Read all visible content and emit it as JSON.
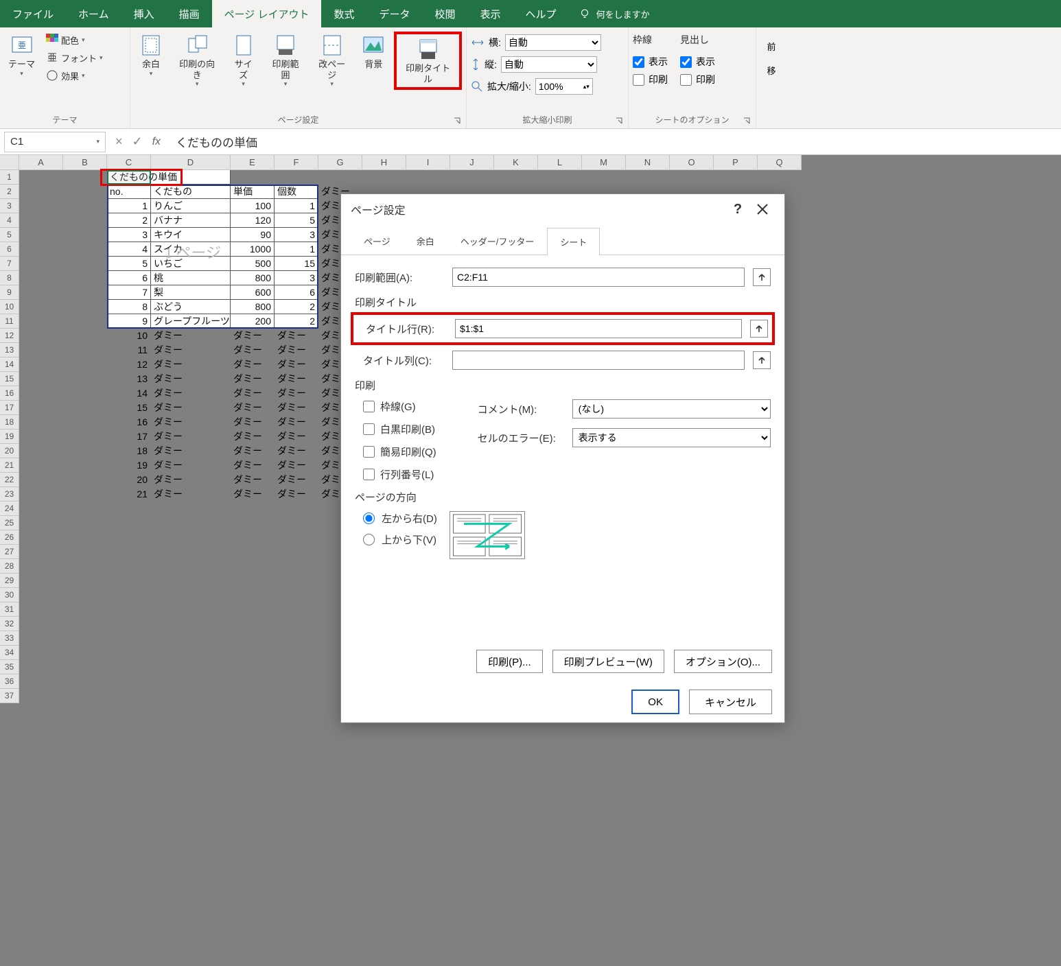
{
  "ribbonTabs": {
    "file": "ファイル",
    "home": "ホーム",
    "insert": "挿入",
    "draw": "描画",
    "pageLayout": "ページ レイアウト",
    "formulas": "数式",
    "data": "データ",
    "review": "校閲",
    "view": "表示",
    "help": "ヘルプ",
    "tellMe": "何をしますか"
  },
  "ribbon": {
    "themes": {
      "label": "テーマ",
      "theme": "テーマ",
      "colors": "配色",
      "fonts": "フォント",
      "effects": "効果"
    },
    "pageSetup": {
      "label": "ページ設定",
      "margins": "余白",
      "orientation": "印刷の向き",
      "size": "サイズ",
      "printArea": "印刷範囲",
      "breaks": "改ページ",
      "background": "背景",
      "printTitles": "印刷タイトル"
    },
    "scale": {
      "label": "拡大縮小印刷",
      "width": "横:",
      "height": "縦:",
      "auto": "自動",
      "scale": "拡大/縮小:",
      "scaleVal": "100%"
    },
    "sheetOptions": {
      "label": "シートのオプション",
      "gridlines": "枠線",
      "headings": "見出し",
      "view": "表示",
      "print": "印刷"
    },
    "arrange": {
      "label1": "前",
      "label2": "移"
    }
  },
  "namebox": "C1",
  "formulaText": "くだものの単価",
  "columns": [
    "A",
    "B",
    "C",
    "D",
    "E",
    "F",
    "G",
    "H",
    "I",
    "J",
    "K",
    "L",
    "M",
    "N",
    "O",
    "P",
    "Q"
  ],
  "rowCount": 37,
  "pageWatermark": "1 ページ",
  "table": {
    "title": "くだものの単価",
    "headers": {
      "no": "no.",
      "fruit": "くだもの",
      "price": "単価",
      "qty": "個数"
    },
    "rows": [
      {
        "no": 1,
        "fruit": "りんご",
        "price": 100,
        "qty": 1
      },
      {
        "no": 2,
        "fruit": "バナナ",
        "price": 120,
        "qty": 5
      },
      {
        "no": 3,
        "fruit": "キウイ",
        "price": 90,
        "qty": 3
      },
      {
        "no": 4,
        "fruit": "スイカ",
        "price": 1000,
        "qty": 1
      },
      {
        "no": 5,
        "fruit": "いちご",
        "price": 500,
        "qty": 15
      },
      {
        "no": 6,
        "fruit": "桃",
        "price": 800,
        "qty": 3
      },
      {
        "no": 7,
        "fruit": "梨",
        "price": 600,
        "qty": 6
      },
      {
        "no": 8,
        "fruit": "ぶどう",
        "price": 800,
        "qty": 2
      },
      {
        "no": 9,
        "fruit": "グレープフルーツ",
        "price": 200,
        "qty": 2
      }
    ],
    "dummyLabel": "ダミー",
    "dummyRowsStart": 10,
    "dummyRowsEnd": 21
  },
  "dialog": {
    "title": "ページ設定",
    "tabs": {
      "page": "ページ",
      "margins": "余白",
      "headerFooter": "ヘッダー/フッター",
      "sheet": "シート"
    },
    "printRangeLabel": "印刷範囲(A):",
    "printRangeValue": "C2:F11",
    "printTitleSection": "印刷タイトル",
    "titleRowLabel": "タイトル行(R):",
    "titleRowValue": "$1:$1",
    "titleColLabel": "タイトル列(C):",
    "titleColValue": "",
    "printSection": "印刷",
    "gridlines": "枠線(G)",
    "blackWhite": "白黒印刷(B)",
    "draft": "簡易印刷(Q)",
    "rowColHeadings": "行列番号(L)",
    "commentsLabel": "コメント(M):",
    "commentsValue": "(なし)",
    "cellErrLabel": "セルのエラー(E):",
    "cellErrValue": "表示する",
    "orderSection": "ページの方向",
    "leftRight": "左から右(D)",
    "topBottom": "上から下(V)",
    "printBtn": "印刷(P)...",
    "previewBtn": "印刷プレビュー(W)",
    "optionsBtn": "オプション(O)...",
    "ok": "OK",
    "cancel": "キャンセル"
  }
}
